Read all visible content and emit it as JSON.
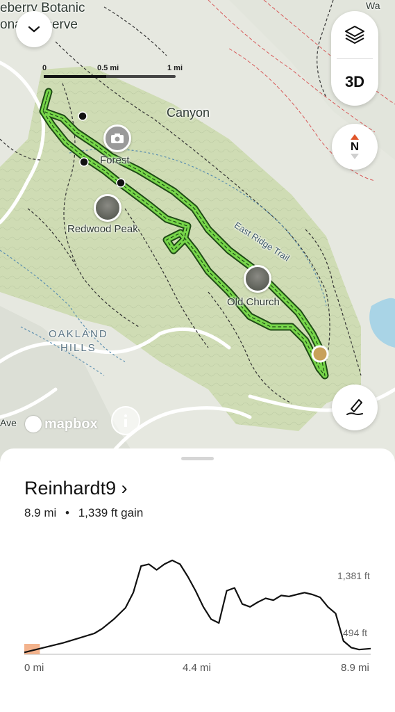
{
  "map": {
    "top_left_label": "eberry Botanic\nonal Reserve",
    "place_labels": {
      "canyon": "Canyon",
      "forest": "Forest",
      "redwood_peak": "Redwood Peak",
      "old_church": "Old Church",
      "oakland_hills": "OAKLAND\nHILLS",
      "ave": "Ave",
      "wa": "Wa"
    },
    "trail_label": "East Ridge Trail",
    "scale": {
      "start": "0",
      "mid": "0.5 mi",
      "end": "1 mi"
    },
    "attribution": "mapbox",
    "controls": {
      "collapse_icon": "chevron-down-icon",
      "layers_icon": "layers-icon",
      "view_3d": "3D",
      "compass": "N",
      "draw_icon": "draw-route-icon"
    },
    "colors": {
      "route": "#77d64a",
      "route_outline": "#1f4a16",
      "terrain": "#cfdcb4",
      "end_marker": "#c8a15a"
    }
  },
  "route": {
    "name": "Reinhardt9",
    "chevron": "›",
    "distance": "8.9 mi",
    "separator": "•",
    "gain": "1,339 ft gain"
  },
  "chart_data": {
    "type": "area",
    "title": "",
    "x_unit": "mi",
    "y_unit": "ft",
    "x_ticks": [
      "0 mi",
      "4.4 mi",
      "8.9 mi"
    ],
    "y_markers": [
      "1,381 ft",
      "494 ft"
    ],
    "xlim": [
      0,
      8.9
    ],
    "ylim": [
      350,
      1420
    ],
    "x": [
      0,
      0.3,
      0.6,
      1.0,
      1.4,
      1.8,
      2.0,
      2.3,
      2.6,
      2.8,
      3.0,
      3.2,
      3.4,
      3.6,
      3.8,
      4.0,
      4.2,
      4.4,
      4.6,
      4.8,
      5.0,
      5.2,
      5.4,
      5.6,
      5.8,
      6.0,
      6.2,
      6.4,
      6.6,
      6.8,
      7.0,
      7.2,
      7.4,
      7.6,
      7.8,
      8.0,
      8.2,
      8.4,
      8.6,
      8.9
    ],
    "y": [
      370,
      400,
      430,
      470,
      520,
      570,
      620,
      720,
      840,
      1000,
      1280,
      1300,
      1240,
      1300,
      1340,
      1300,
      1170,
      1020,
      850,
      720,
      680,
      1020,
      1050,
      880,
      850,
      900,
      940,
      920,
      970,
      960,
      980,
      1000,
      980,
      950,
      850,
      780,
      490,
      420,
      400,
      410
    ],
    "highlight": {
      "from": 0,
      "to": 0.4,
      "color": "#f0a070"
    }
  }
}
